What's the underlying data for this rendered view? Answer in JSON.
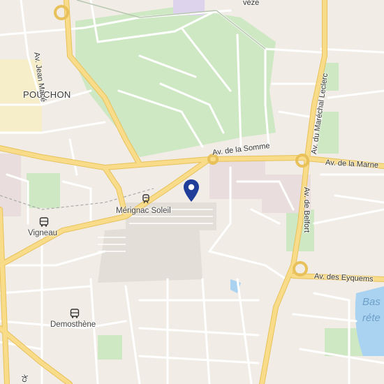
{
  "map": {
    "places": {
      "pouchon": "POUCHON",
      "merignac_soleil": "Mérignac Soleil",
      "vigneau": "Vigneau",
      "demosthene": "Demosthène"
    },
    "roads": {
      "av_jean_mace": "Av. Jean Macé",
      "av_somme": "Av. de la Somme",
      "av_marne": "Av. de la Marne",
      "av_marechal_leclerc": "Av. du Maréchal Leclerc",
      "av_belfort": "Av. de Belfort",
      "av_eyquems": "Av. des Eyquems",
      "top_fragment": "vèze",
      "bottom_left_fragment": "ck"
    },
    "water": {
      "line1": "Bas",
      "line2": "réte"
    },
    "icons": {
      "marker": "location-pin-icon",
      "bus": "bus-stop-icon",
      "tram": "tram-stop-icon"
    },
    "colors": {
      "land": "#f1ede6",
      "park": "#cfe8c4",
      "highway": "#f5d37a",
      "street": "#ffffff",
      "water": "#aad3f2",
      "marker": "#1f3d99"
    }
  }
}
